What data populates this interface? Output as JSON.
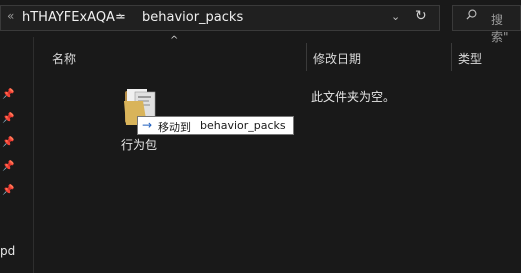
{
  "address_bar": {
    "back_glyph": "«",
    "crumb_1": "hTHAYFExAQA=",
    "chevron": "›",
    "crumb_2": "behavior_packs",
    "dropdown": "⌄",
    "refresh": "↻"
  },
  "search": {
    "placeholder": "搜索\""
  },
  "columns": {
    "name": "名称",
    "date": "修改日期",
    "type": "类型"
  },
  "sidebar": {
    "partial_label": "pd"
  },
  "content": {
    "empty_message": "此文件夹为空。"
  },
  "drag": {
    "caption": "行为包",
    "tooltip_action": "移动到",
    "tooltip_target": "behavior_packs"
  },
  "colors": {
    "background": "#191919",
    "tooltip_bg": "#ffffff",
    "tooltip_arrow": "#1f5fbf"
  }
}
